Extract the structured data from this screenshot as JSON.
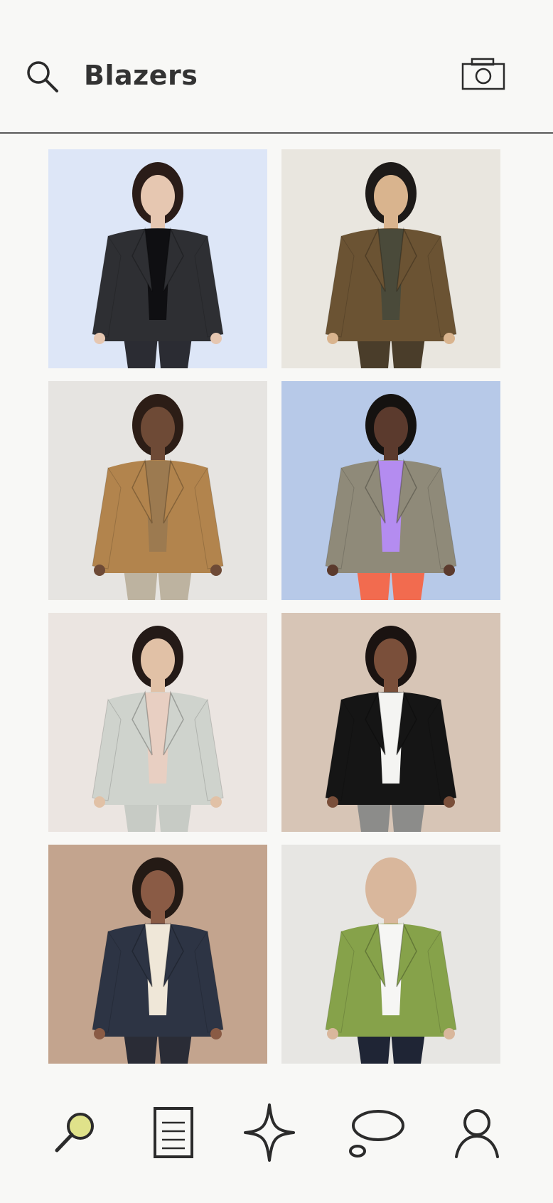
{
  "header": {
    "title": "Blazers",
    "search_icon": "search-icon",
    "camera_icon": "camera-icon"
  },
  "results": [
    {
      "id": 1,
      "description_icon": "product-image",
      "bg": "#dde6f7",
      "jacket": "#2e2f33",
      "top": "#0f0f12",
      "pants": "#2b2c33",
      "skin": "#e6c7b1",
      "hair": "#2a1c18"
    },
    {
      "id": 2,
      "description_icon": "product-image",
      "bg": "#e9e6df",
      "jacket": "#6b5333",
      "top": "#4a4a3a",
      "pants": "#4a3d2a",
      "skin": "#d9b48e",
      "hair": "#1d1a18"
    },
    {
      "id": 3,
      "description_icon": "product-image",
      "bg": "#e6e4e1",
      "jacket": "#b2844d",
      "top": "#9c7a50",
      "pants": "#bdb3a0",
      "skin": "#6e4a36",
      "hair": "#2c1d16"
    },
    {
      "id": 4,
      "description_icon": "product-image",
      "bg": "#b7c9e8",
      "jacket": "#8f8a79",
      "top": "#b48cf0",
      "pants": "#f26b4f",
      "skin": "#5b3a2d",
      "hair": "#151210"
    },
    {
      "id": 5,
      "description_icon": "product-image",
      "bg": "#ebe5e1",
      "jacket": "#cfd3cd",
      "top": "#e8cfc2",
      "pants": "#c7cbc5",
      "skin": "#e1c1a6",
      "hair": "#241a17"
    },
    {
      "id": 6,
      "description_icon": "product-image",
      "bg": "#d7c5b6",
      "jacket": "#151515",
      "top": "#f4f4f2",
      "pants": "#8c8c8a",
      "skin": "#7a4f3a",
      "hair": "#1a1311"
    },
    {
      "id": 7,
      "description_icon": "product-image",
      "bg": "#c3a48e",
      "jacket": "#2d3444",
      "top": "#efe7d8",
      "pants": "#2a2c36",
      "skin": "#8a5b45",
      "hair": "#241a15"
    },
    {
      "id": 8,
      "description_icon": "product-image",
      "bg": "#e7e6e3",
      "jacket": "#86a24a",
      "top": "#f6f6f4",
      "pants": "#1f2535",
      "skin": "#d9b79c",
      "hair": "#d9b79c"
    }
  ],
  "bottom_nav": [
    {
      "name": "search-tab",
      "icon": "search-icon",
      "active": true,
      "accent": "#dfe28a"
    },
    {
      "name": "list-tab",
      "icon": "document-icon",
      "active": false
    },
    {
      "name": "discover-tab",
      "icon": "sparkle-icon",
      "active": false
    },
    {
      "name": "chat-tab",
      "icon": "chat-bubble-icon",
      "active": false
    },
    {
      "name": "profile-tab",
      "icon": "profile-icon",
      "active": false
    }
  ],
  "colors": {
    "background": "#f8f8f6",
    "text": "#333333",
    "divider": "#5a5a5a",
    "icon_stroke": "#2b2b2b",
    "active_accent": "#dfe28a"
  }
}
